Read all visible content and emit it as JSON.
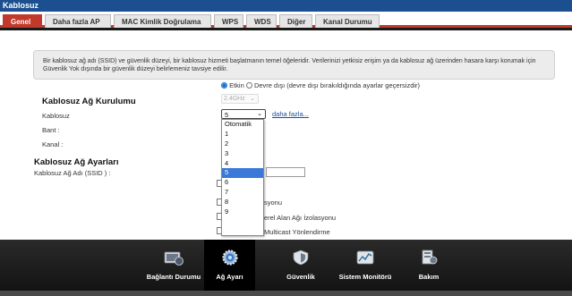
{
  "title": "Kablosuz",
  "tabs": [
    {
      "label": "Genel",
      "active": true
    },
    {
      "label": "Daha fazla AP",
      "active": false
    },
    {
      "label": "MAC Kimlik Doğrulama",
      "active": false
    },
    {
      "label": "WPS",
      "active": false
    },
    {
      "label": "WDS",
      "active": false
    },
    {
      "label": "Diğer",
      "active": false
    },
    {
      "label": "Kanal Durumu",
      "active": false
    }
  ],
  "notice": "Bir kablosuz ağ adı (SSID) ve güvenlik düzeyi, bir kablosuz hizmeti başlatmanın temel öğeleridir. Verilerinizi yetkisiz erişim ya da kablosuz ağ üzerinden hasara karşı korumak için Güvenlik Yok dışında bir güvenlik düzeyi belirlemeniz tavsiye edilir.",
  "setup": {
    "heading": "Kablosuz Ağ Kurulumu",
    "wireless_label": "Kablosuz",
    "radio_on": "Etkin",
    "radio_off": "Devre dışı (devre dışı bırakıldığında ayarlar geçersizdir)",
    "band_label": "Bant :",
    "band_value": "2.4GHz",
    "channel_label": "Kanal :",
    "channel_value": "5",
    "more_link": "daha fazla..."
  },
  "settings": {
    "heading": "Kablosuz Ağ Ayarları",
    "ssid_label": "Kablosuz Ağ Adı (SSID ) :",
    "ssid_value": "",
    "partial1": "syonu",
    "partial2": "erel Alan Ağı İzolasyonu",
    "partial3": "Multicast Yönlendirme"
  },
  "channel_options": [
    "Otomatik",
    "1",
    "2",
    "3",
    "4",
    "5",
    "6",
    "7",
    "8",
    "9"
  ],
  "channel_selected_index": 5,
  "footer_nav": [
    {
      "label": "Bağlantı Durumu",
      "icon": "connection-status-icon",
      "active": false
    },
    {
      "label": "Ağ Ayarı",
      "icon": "network-settings-gear-icon",
      "active": true
    },
    {
      "label": "Güvenlik",
      "icon": "security-shield-icon",
      "active": false
    },
    {
      "label": "Sistem Monitörü",
      "icon": "system-monitor-icon",
      "active": false
    },
    {
      "label": "Bakım",
      "icon": "maintenance-icon",
      "active": false
    }
  ],
  "colors": {
    "title_bar": "#1b4f8f",
    "accent": "#c0392b",
    "selection": "#3b78d8"
  }
}
